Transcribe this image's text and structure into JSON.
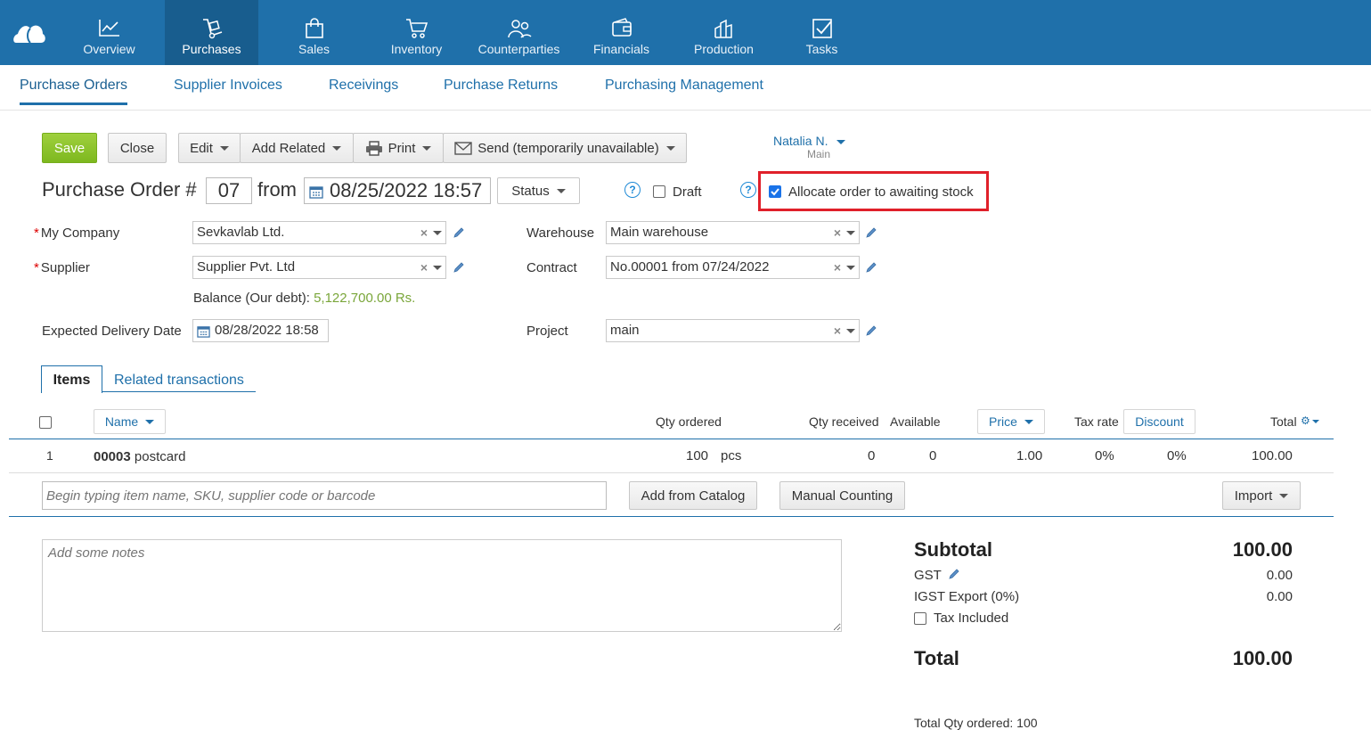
{
  "nav": {
    "items": [
      {
        "label": "Overview",
        "icon": "chart-line-icon"
      },
      {
        "label": "Purchases",
        "icon": "dolly-icon",
        "active": true
      },
      {
        "label": "Sales",
        "icon": "shopping-bag-icon"
      },
      {
        "label": "Inventory",
        "icon": "cart-icon"
      },
      {
        "label": "Counterparties",
        "icon": "people-icon"
      },
      {
        "label": "Financials",
        "icon": "wallet-icon"
      },
      {
        "label": "Production",
        "icon": "factory-icon"
      },
      {
        "label": "Tasks",
        "icon": "task-check-icon"
      }
    ]
  },
  "subnav": {
    "items": [
      "Purchase Orders",
      "Supplier Invoices",
      "Receivings",
      "Purchase Returns",
      "Purchasing Management"
    ],
    "active": "Purchase Orders"
  },
  "toolbar": {
    "save": "Save",
    "close": "Close",
    "edit": "Edit",
    "add_related": "Add Related",
    "print": "Print",
    "send": "Send (temporarily unavailable)"
  },
  "user": {
    "name": "Natalia N.",
    "role": "Main"
  },
  "order": {
    "title": "Purchase Order #",
    "number": "07",
    "from_label": "from",
    "datetime": "08/25/2022 18:57",
    "status_label": "Status",
    "draft_label": "Draft",
    "draft_checked": false,
    "help_glyph": "?",
    "allocate_label": "Allocate order to awaiting stock",
    "allocate_checked": true
  },
  "form": {
    "my_company_label": "My Company",
    "my_company_value": "Sevkavlab Ltd.",
    "supplier_label": "Supplier",
    "supplier_value": "Supplier Pvt. Ltd",
    "balance_label": "Balance (Our debt):",
    "balance_value": "5,122,700.00 Rs.",
    "expected_label": "Expected Delivery Date",
    "expected_value": "08/28/2022 18:58",
    "warehouse_label": "Warehouse",
    "warehouse_value": "Main warehouse",
    "contract_label": "Contract",
    "contract_value": "No.00001 from 07/24/2022",
    "project_label": "Project",
    "project_value": "main",
    "clear_glyph": "×"
  },
  "tabs": {
    "items": "Items",
    "related": "Related transactions"
  },
  "table": {
    "headers": {
      "name": "Name",
      "qty_ordered": "Qty ordered",
      "qty_received": "Qty received",
      "available": "Available",
      "price": "Price",
      "tax_rate": "Tax rate",
      "discount": "Discount",
      "total": "Total"
    },
    "rows": [
      {
        "index": "1",
        "code": "00003",
        "name": "postcard",
        "qty": "100",
        "unit": "pcs",
        "received": "0",
        "available": "0",
        "price": "1.00",
        "tax_rate": "0%",
        "discount": "0%",
        "total": "100.00"
      }
    ]
  },
  "add_row": {
    "placeholder": "Begin typing item name, SKU, supplier code or barcode",
    "add_from_catalog": "Add from Catalog",
    "manual_counting": "Manual Counting",
    "import": "Import"
  },
  "notes": {
    "placeholder": "Add some notes"
  },
  "summary": {
    "subtotal_label": "Subtotal",
    "subtotal_value": "100.00",
    "gst_label": "GST",
    "gst_value": "0.00",
    "igst_label": "IGST Export (0%)",
    "igst_value": "0.00",
    "tax_included_label": "Tax Included",
    "total_label": "Total",
    "total_value": "100.00",
    "total_qty_label": "Total Qty ordered:",
    "total_qty_value": "100"
  },
  "colors": {
    "nav_bg": "#1f70aa",
    "accent": "#1f70aa",
    "save_green": "#8cc42b",
    "highlight_red": "#e0202a",
    "balance_green": "#7aa63a"
  }
}
